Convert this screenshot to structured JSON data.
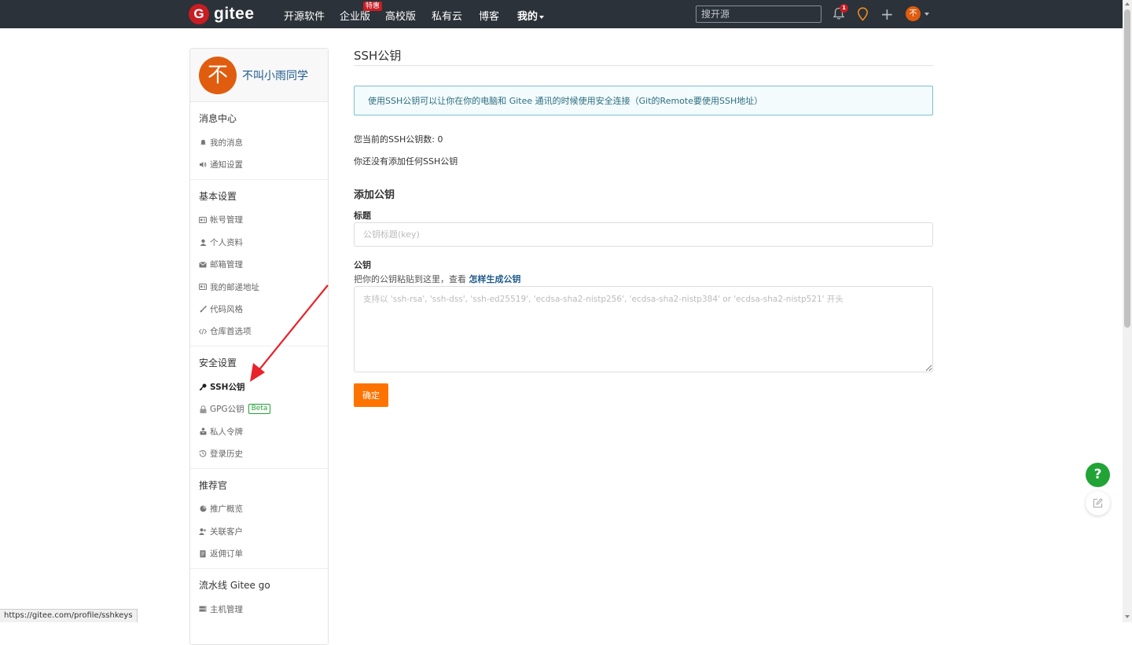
{
  "navbar": {
    "logo_mark": "G",
    "logo_text": "gitee",
    "items": [
      "开源软件",
      "企业版",
      "高校版",
      "私有云",
      "博客",
      "我的"
    ],
    "badge": "特惠",
    "search_placeholder": "搜开源",
    "notification_count": "1",
    "avatar_text": "不",
    "icons": [
      "bell-icon",
      "location-pin-icon",
      "plus-icon",
      "chevron-down-icon"
    ]
  },
  "sidebar": {
    "profile": {
      "avatar_text": "不",
      "name": "不叫小雨同学"
    },
    "groups": [
      {
        "title": "消息中心",
        "items": [
          {
            "label": "我的消息",
            "icon": "bell-icon"
          },
          {
            "label": "通知设置",
            "icon": "speaker-icon"
          }
        ]
      },
      {
        "title": "基本设置",
        "items": [
          {
            "label": "帐号管理",
            "icon": "id-card-icon"
          },
          {
            "label": "个人资料",
            "icon": "user-icon"
          },
          {
            "label": "邮箱管理",
            "icon": "envelope-icon"
          },
          {
            "label": "我的邮递地址",
            "icon": "address-card-icon"
          },
          {
            "label": "代码风格",
            "icon": "brush-icon"
          },
          {
            "label": "仓库首选项",
            "icon": "code-icon"
          }
        ]
      },
      {
        "title": "安全设置",
        "items": [
          {
            "label": "SSH公钥",
            "icon": "key-icon",
            "active": true
          },
          {
            "label": "GPG公钥",
            "icon": "lock-icon",
            "badge": "Beta"
          },
          {
            "label": "私人令牌",
            "icon": "token-icon"
          },
          {
            "label": "登录历史",
            "icon": "history-icon"
          }
        ]
      },
      {
        "title": "推荐官",
        "items": [
          {
            "label": "推广概览",
            "icon": "chart-icon"
          },
          {
            "label": "关联客户",
            "icon": "users-icon"
          },
          {
            "label": "返佣订单",
            "icon": "order-icon"
          }
        ]
      },
      {
        "title": "流水线 Gitee go",
        "items": [
          {
            "label": "主机管理",
            "icon": "server-icon"
          }
        ]
      }
    ]
  },
  "main": {
    "title": "SSH公钥",
    "info": "使用SSH公钥可以让你在你的电脑和 Gitee 通讯的时候使用安全连接（Git的Remote要使用SSH地址）",
    "count": "您当前的SSH公钥数: 0",
    "none": "你还没有添加任何SSH公钥",
    "add_title": "添加公钥",
    "title_label": "标题",
    "title_placeholder": "公钥标题(key)",
    "key_label": "公钥",
    "hint_prefix": "把你的公钥粘贴到这里，查看 ",
    "hint_link": "怎样生成公钥",
    "key_placeholder": "支持以 'ssh-rsa', 'ssh-dss', 'ssh-ed25519', 'ecdsa-sha2-nistp256', 'ecdsa-sha2-nistp384' or 'ecdsa-sha2-nistp521' 开头",
    "submit": "确定"
  },
  "floating": {
    "help": "?"
  },
  "statusbar": {
    "url": "https://gitee.com/profile/sshkeys"
  },
  "colors": {
    "navbar": "#2b3239",
    "brand_red": "#c71d23",
    "avatar_orange": "#e05d0f",
    "submit_orange": "#fe7300",
    "help_green": "#21a336",
    "link_blue": "#1e5a8b",
    "annotation_arrow": "#e8232a"
  }
}
